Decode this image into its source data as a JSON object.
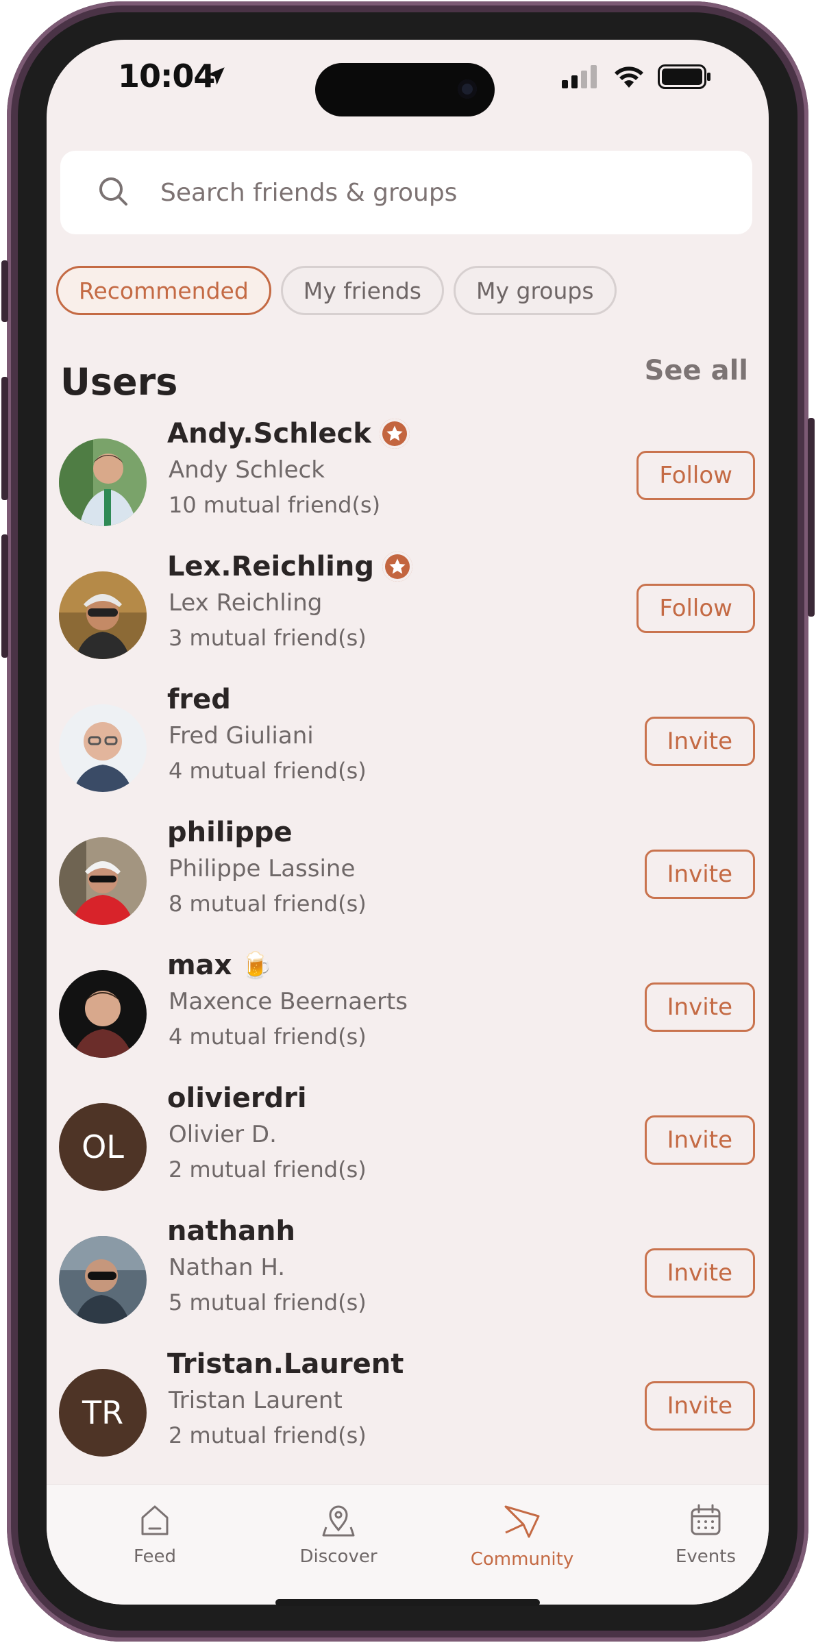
{
  "status": {
    "time": "10:04"
  },
  "search": {
    "placeholder": "Search friends & groups"
  },
  "filters": [
    {
      "label": "Recommended",
      "active": true
    },
    {
      "label": "My friends",
      "active": false
    },
    {
      "label": "My groups",
      "active": false
    }
  ],
  "section": {
    "title": "Users",
    "see_all": "See all"
  },
  "users": [
    {
      "username": "Andy.Schleck",
      "name": "Andy Schleck",
      "mutual": "10 mutual friend(s)",
      "action": "Follow",
      "badge": "star",
      "avatar": "photo"
    },
    {
      "username": "Lex.Reichling",
      "name": "Lex Reichling",
      "mutual": "3 mutual friend(s)",
      "action": "Follow",
      "badge": "star",
      "avatar": "photo"
    },
    {
      "username": "fred",
      "name": "Fred Giuliani",
      "mutual": "4 mutual friend(s)",
      "action": "Invite",
      "avatar": "photo"
    },
    {
      "username": "philippe",
      "name": "Philippe Lassine",
      "mutual": "8 mutual friend(s)",
      "action": "Invite",
      "avatar": "photo"
    },
    {
      "username": "max",
      "emoji": "🍺",
      "name": "Maxence Beernaerts",
      "mutual": "4 mutual friend(s)",
      "action": "Invite",
      "avatar": "photo"
    },
    {
      "username": "olivierdri",
      "name": "Olivier D.",
      "mutual": "2 mutual friend(s)",
      "action": "Invite",
      "initials": "OL"
    },
    {
      "username": "nathanh",
      "name": "Nathan H.",
      "mutual": "5 mutual friend(s)",
      "action": "Invite",
      "avatar": "photo"
    },
    {
      "username": "Tristan.Laurent",
      "name": "Tristan Laurent",
      "mutual": "2 mutual friend(s)",
      "action": "Invite",
      "initials": "TR"
    }
  ],
  "tabs": [
    {
      "label": "Feed",
      "icon": "feed-icon",
      "active": false
    },
    {
      "label": "Discover",
      "icon": "map-pin-icon",
      "active": false
    },
    {
      "label": "Community",
      "icon": "community-icon",
      "active": true
    },
    {
      "label": "Events",
      "icon": "calendar-icon",
      "active": false
    }
  ],
  "colors": {
    "accent": "#C46A44",
    "background": "#F5EEEE",
    "text": "#2A2525"
  }
}
